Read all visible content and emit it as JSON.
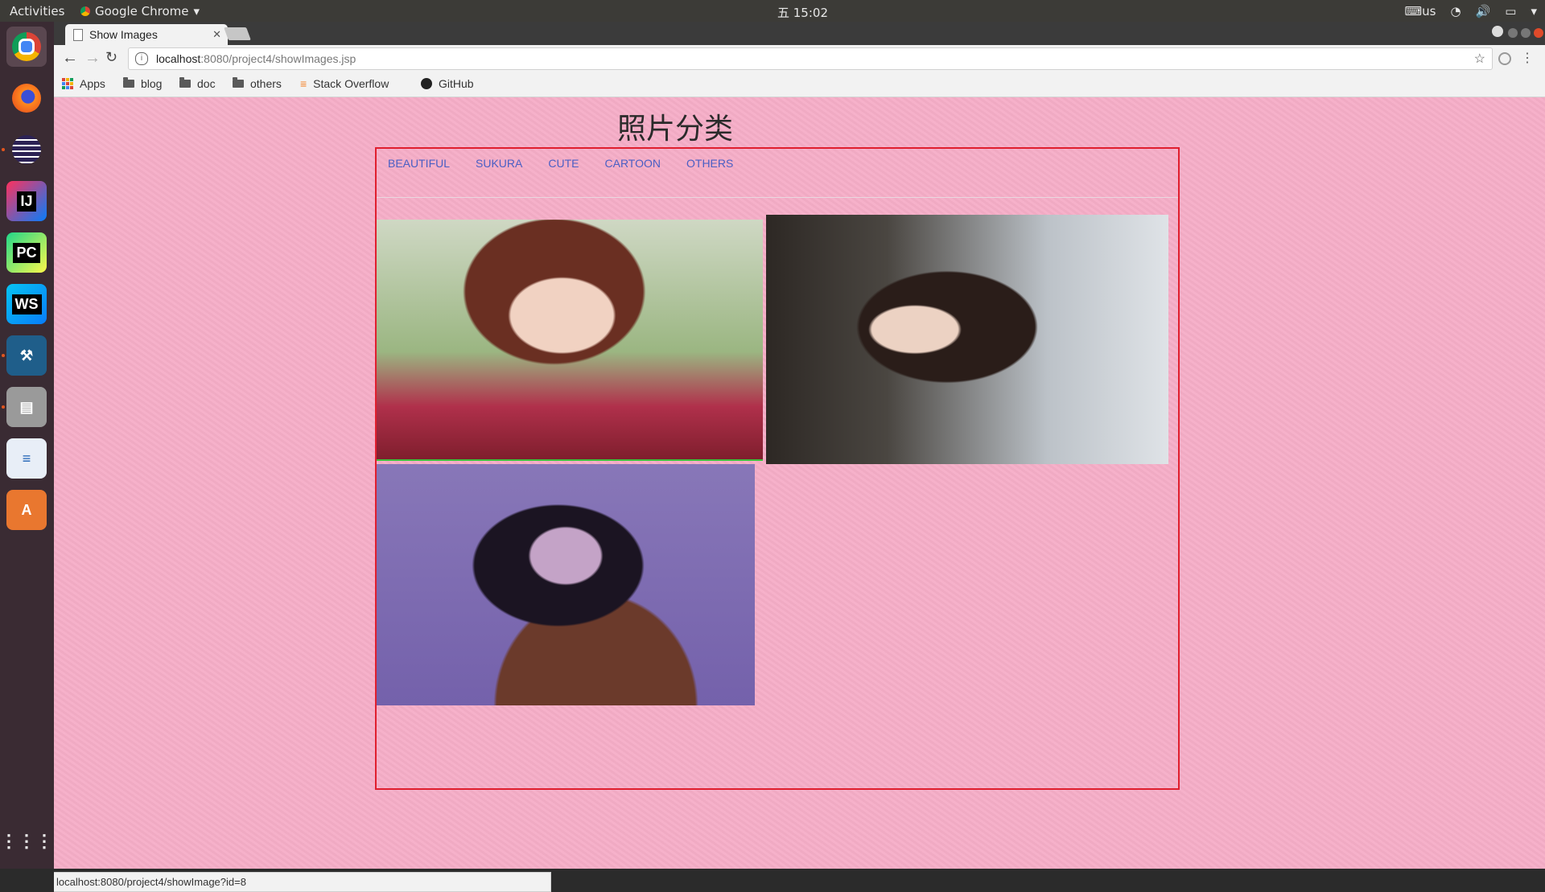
{
  "desktop": {
    "activities": "Activities",
    "app_name": "Google Chrome",
    "clock": "五 15:02",
    "keyboard_layout": "us",
    "launcher": [
      "chrome-icon",
      "firefox-icon",
      "eclipse-icon",
      "intellij-icon",
      "pycharm-icon",
      "webstorm-icon",
      "mysql-workbench-icon",
      "files-icon",
      "writer-icon",
      "software-center-icon",
      "show-apps-icon"
    ]
  },
  "browser": {
    "tab_title": "Show Images",
    "url_host": "localhost",
    "url_path": ":8080/project4/showImages.jsp",
    "bookmarks": [
      "Apps",
      "blog",
      "doc",
      "others",
      "Stack Overflow",
      "GitHub"
    ],
    "status_url": "localhost:8080/project4/showImage?id=8"
  },
  "page": {
    "title": "照片分类",
    "categories": [
      "BEAUTIFUL",
      "SUKURA",
      "CUTE",
      "CARTOON",
      "OTHERS"
    ],
    "photos": [
      "photo-1",
      "photo-2",
      "photo-3"
    ],
    "colors": {
      "background": "#f5adc7",
      "frame_border": "#e01e2e",
      "link": "#4a5fc4"
    }
  }
}
